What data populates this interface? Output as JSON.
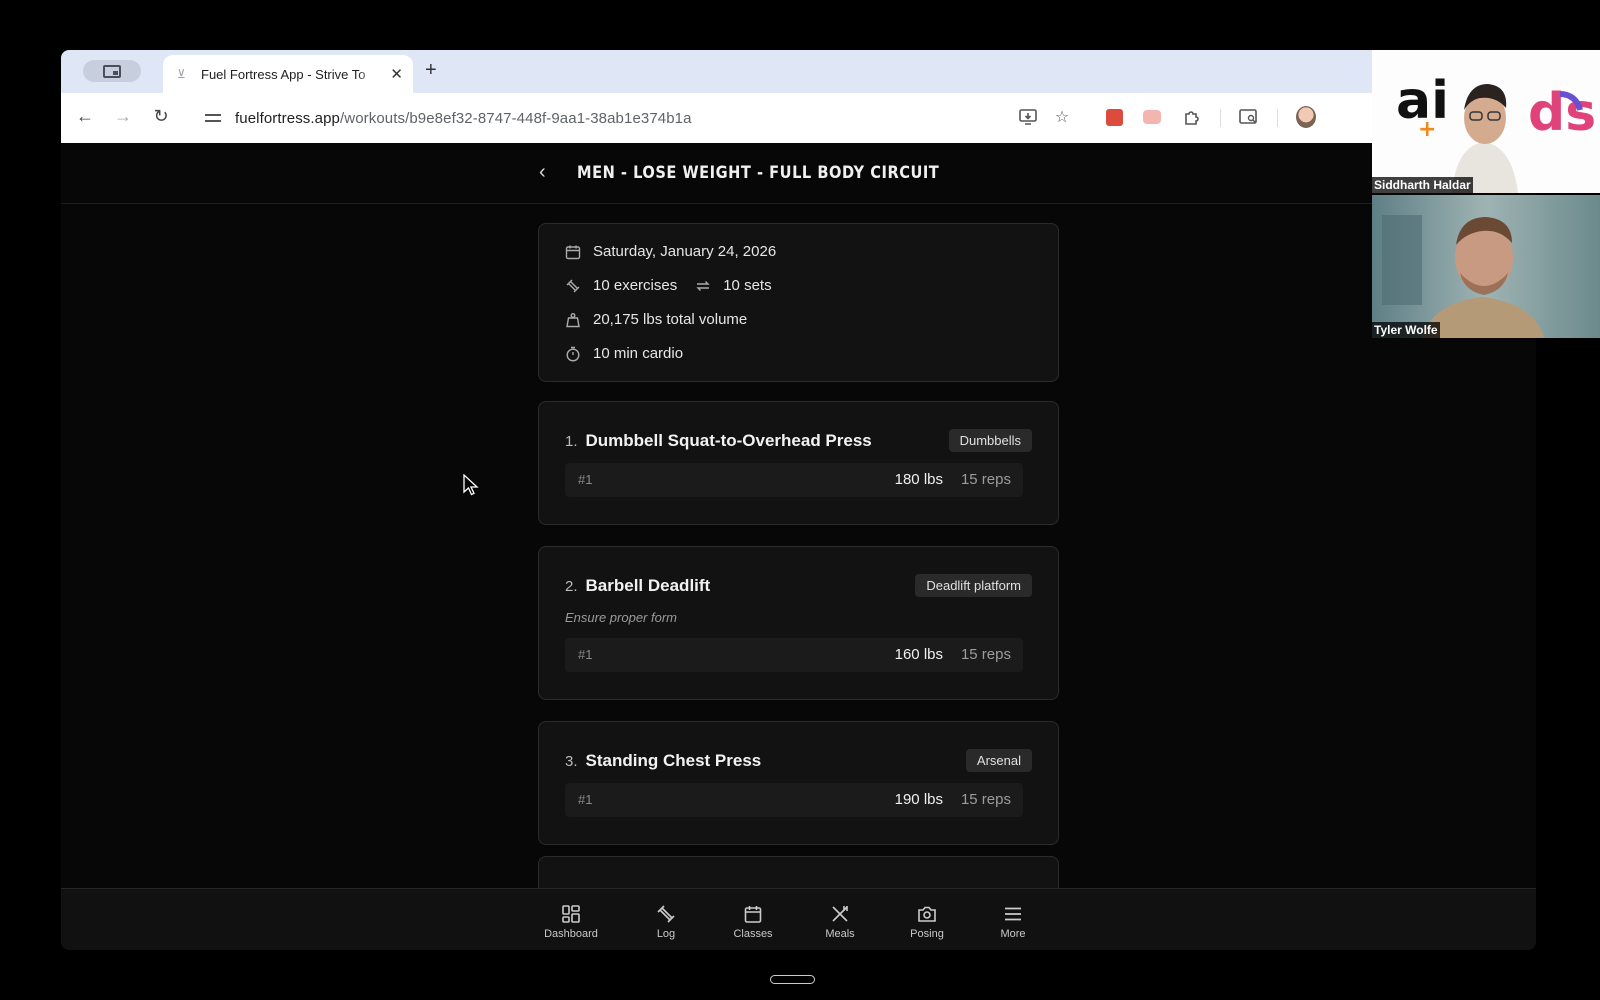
{
  "browser": {
    "tab_title": "Fuel Fortress App - Strive To",
    "url_domain": "fuelfortress.app",
    "url_path": "/workouts/b9e8ef32-8747-448f-9aa1-38ab1e374b1a"
  },
  "header": {
    "title": "MEN - LOSE WEIGHT - FULL BODY CIRCUIT"
  },
  "summary": {
    "date": "Saturday, January 24, 2026",
    "exercises": "10 exercises",
    "sets": "10 sets",
    "volume": "20,175 lbs total volume",
    "cardio": "10 min cardio"
  },
  "exercises": [
    {
      "num": "1.",
      "name": "Dumbbell Squat-to-Overhead Press",
      "equipment": "Dumbbells",
      "note": "",
      "sets": [
        {
          "idx": "#1",
          "weight": "180 lbs",
          "reps": "15 reps"
        }
      ]
    },
    {
      "num": "2.",
      "name": "Barbell Deadlift",
      "equipment": "Deadlift platform",
      "note": "Ensure proper form",
      "sets": [
        {
          "idx": "#1",
          "weight": "160 lbs",
          "reps": "15 reps"
        }
      ]
    },
    {
      "num": "3.",
      "name": "Standing Chest Press",
      "equipment": "Arsenal",
      "note": "",
      "sets": [
        {
          "idx": "#1",
          "weight": "190 lbs",
          "reps": "15 reps"
        }
      ]
    }
  ],
  "bottom_nav": [
    {
      "label": "Dashboard",
      "icon": "dashboard-icon"
    },
    {
      "label": "Log",
      "icon": "dumbbell-icon"
    },
    {
      "label": "Classes",
      "icon": "calendar-icon"
    },
    {
      "label": "Meals",
      "icon": "utensils-icon"
    },
    {
      "label": "Posing",
      "icon": "camera-icon"
    },
    {
      "label": "More",
      "icon": "menu-icon"
    }
  ],
  "video_tiles": [
    {
      "name": "Siddharth Haldar"
    },
    {
      "name": "Tyler Wolfe"
    }
  ],
  "colors": {
    "app_bg": "#070707",
    "card_bg": "#121212",
    "badge_bg": "#2a2a2a"
  }
}
